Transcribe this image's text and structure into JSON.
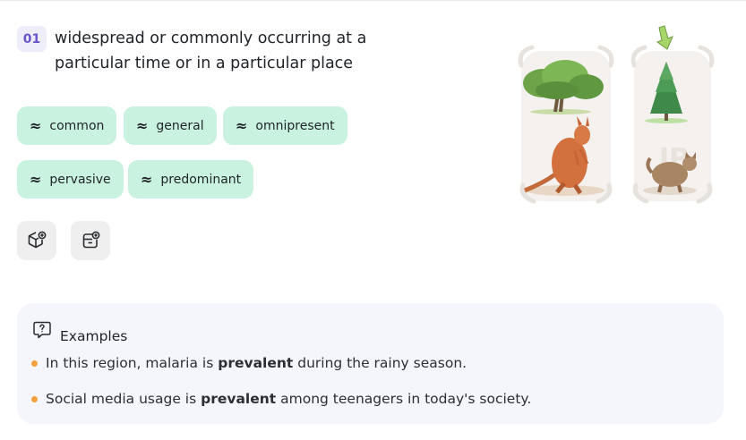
{
  "entry": {
    "number": "01",
    "definition": "widespread or commonly occurring at a particular time or in a particular place"
  },
  "synonyms": [
    {
      "symbol": "≈",
      "label": "common"
    },
    {
      "symbol": "≈",
      "label": "general"
    },
    {
      "symbol": "≈",
      "label": "omnipresent"
    },
    {
      "symbol": "≈",
      "label": "pervasive"
    },
    {
      "symbol": "≈",
      "label": "predominant"
    }
  ],
  "tools": [
    {
      "icon": "cube-add-icon"
    },
    {
      "icon": "folder-add-icon"
    }
  ],
  "examples": {
    "title": "Examples",
    "icon": "question-bubble-icon",
    "items": [
      {
        "before": "In this region, malaria is ",
        "highlight": "prevalent",
        "after": " during the rainy season."
      },
      {
        "before": "Social media usage is ",
        "highlight": "prevalent",
        "after": " among teenagers in today's society."
      }
    ]
  },
  "illustration": {
    "icons": [
      "oak-tree-icon",
      "kangaroo-icon",
      "pine-tree-icon",
      "cat-icon",
      "arrow-down-icon"
    ],
    "colors": {
      "chip": "#c9f3e0",
      "badge_text": "#6b54c9",
      "bullet": "#f3a23a"
    }
  }
}
